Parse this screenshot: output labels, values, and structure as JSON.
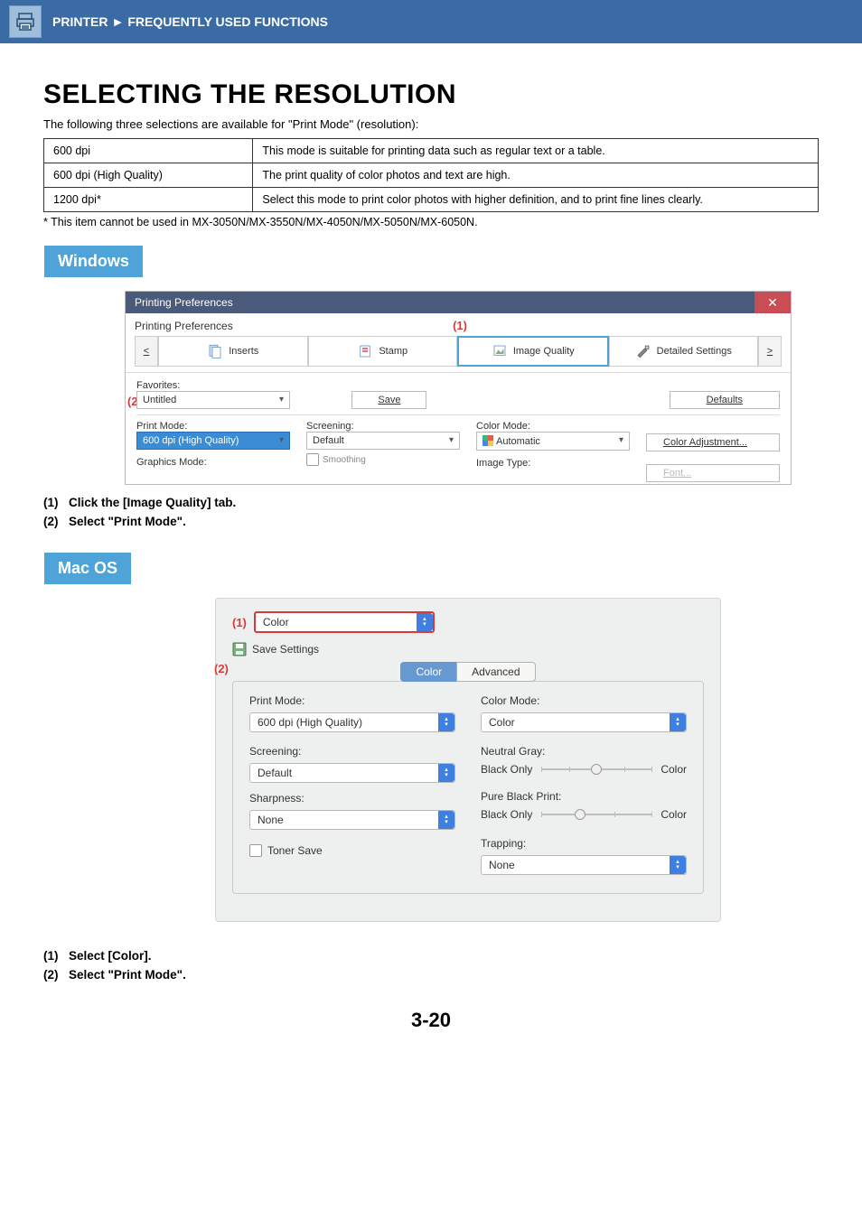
{
  "header": {
    "breadcrumb_a": "PRINTER",
    "breadcrumb_b": "FREQUENTLY USED FUNCTIONS"
  },
  "title": "SELECTING THE RESOLUTION",
  "intro": "The following three selections are available for \"Print Mode\" (resolution):",
  "table": {
    "rows": [
      {
        "name": "600 dpi",
        "desc": "This mode is suitable for printing data such as regular text or a table."
      },
      {
        "name": "600 dpi (High Quality)",
        "desc": "The print quality of color photos and text are high."
      },
      {
        "name": "1200 dpi*",
        "desc": "Select this mode to print color photos with higher definition, and to print fine lines clearly."
      }
    ]
  },
  "footnote": "* This item cannot be used in MX-3050N/MX-3550N/MX-4050N/MX-5050N/MX-6050N.",
  "osTabs": {
    "windows": "Windows",
    "mac": "Mac OS"
  },
  "callouts": {
    "one": "(1)",
    "two": "(2)"
  },
  "winDialog": {
    "title": "Printing Preferences",
    "tabLine": "Printing Preferences",
    "navPrev": "<",
    "navNext": ">",
    "tabs": {
      "inserts": "Inserts",
      "stamp": "Stamp",
      "imageQuality": "Image Quality",
      "detailed": "Detailed Settings"
    },
    "favoritesLabel": "Favorites:",
    "favoritesValue": "Untitled",
    "saveBtn": "Save",
    "defaultsBtn": "Defaults",
    "printModeLabel": "Print Mode:",
    "printModeValue": "600 dpi (High Quality)",
    "screeningLabel": "Screening:",
    "screeningValue": "Default",
    "colorModeLabel": "Color Mode:",
    "colorModeValue": "Automatic",
    "colorAdjBtn": "Color Adjustment...",
    "graphicsLabel": "Graphics Mode:",
    "smoothing": "Smoothing",
    "imageTypeLabel": "Image Type:",
    "fontBtn": "Font..."
  },
  "stepsWin": {
    "s1_num": "(1)",
    "s1_text": "Click the [Image Quality] tab.",
    "s2_num": "(2)",
    "s2_text": "Select \"Print Mode\"."
  },
  "macDialog": {
    "topSel": "Color",
    "saveSettings": "Save Settings",
    "tabColor": "Color",
    "tabAdvanced": "Advanced",
    "printModeLabel": "Print Mode:",
    "printModeValue": "600 dpi (High Quality)",
    "colorModeLabel": "Color Mode:",
    "colorModeValue": "Color",
    "screeningLabel": "Screening:",
    "screeningValue": "Default",
    "neutralGrayLabel": "Neutral Gray:",
    "sliderLeft": "Black Only",
    "sliderRight": "Color",
    "sharpnessLabel": "Sharpness:",
    "sharpnessValue": "None",
    "pureBlackLabel": "Pure Black Print:",
    "tonerSave": "Toner Save",
    "trappingLabel": "Trapping:",
    "trappingValue": "None"
  },
  "stepsMac": {
    "s1_num": "(1)",
    "s1_text": "Select [Color].",
    "s2_num": "(2)",
    "s2_text": "Select \"Print Mode\"."
  },
  "pageNumber": "3-20"
}
